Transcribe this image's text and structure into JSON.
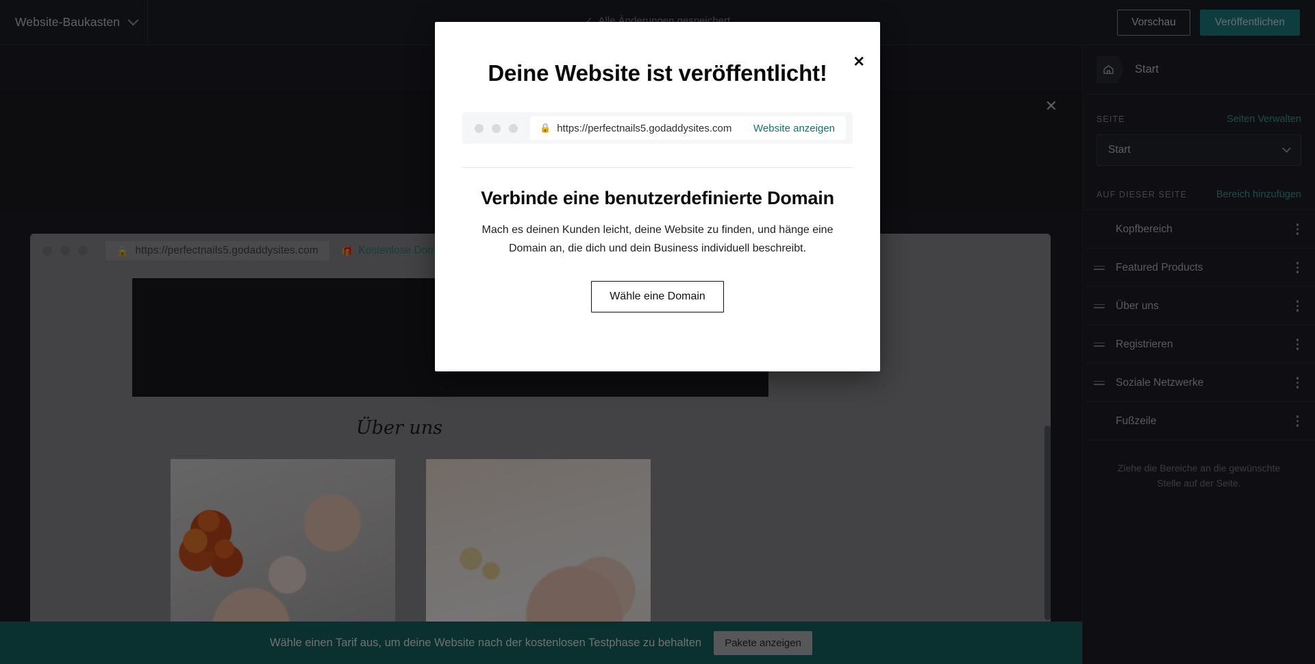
{
  "topbar": {
    "brand": "Website-Baukasten",
    "brand_chevron_icon": "chevron-down-icon",
    "saved_status": "Alle Änderungen gespeichert",
    "saved_check_icon": "check-icon",
    "preview_label": "Vorschau",
    "publish_label": "Veröffentlichen",
    "publish_color": "#127d7b"
  },
  "workarea": {
    "close_icon": "close-icon"
  },
  "preview": {
    "url": "https://perfectnails5.godaddysites.com",
    "lock_icon": "lock-icon",
    "gift_icon": "gift-icon",
    "free_domain_label": "Kostenlose Domain",
    "free_domain_color": "#1f7d74",
    "about_heading": "Über uns",
    "photos": [
      {
        "alt": "manicure-table-with-candles"
      },
      {
        "alt": "soft-spa-hands"
      },
      {
        "alt": "pink-nail-art-with-rose"
      }
    ]
  },
  "sidebar": {
    "page_icon": "home-icon",
    "page_name": "Start",
    "page_section_label": "SEITE",
    "manage_pages_link": "Seiten Verwalten",
    "page_select_value": "Start",
    "page_select_chevron_icon": "chevron-down-icon",
    "on_this_page_label": "AUF DIESER SEITE",
    "add_section_link": "Bereich hinzufügen",
    "sections": [
      {
        "name": "Kopfbereich",
        "draggable": false
      },
      {
        "name": "Featured Products",
        "draggable": true
      },
      {
        "name": "Über uns",
        "draggable": true
      },
      {
        "name": "Registrieren",
        "draggable": true
      },
      {
        "name": "Soziale Netzwerke",
        "draggable": true
      },
      {
        "name": "Fußzeile",
        "draggable": false
      }
    ],
    "hint": "Ziehe die Bereiche an die gewünschte Stelle auf der Seite.",
    "link_color": "#2aa18f"
  },
  "bottombar": {
    "message": "Wähle einen Tarif aus, um deine Website nach der kostenlosen Testphase zu behalten",
    "button_label": "Pakete anzeigen",
    "background": "#0f5f5c"
  },
  "modal": {
    "close_icon": "close-icon",
    "title": "Deine Website ist veröffentlicht!",
    "browser": {
      "lock_icon": "lock-icon",
      "url": "https://perfectnails5.godaddysites.com",
      "view_link": "Website anzeigen",
      "view_link_color": "#12726e"
    },
    "subtitle": "Verbinde eine benutzerdefinierte Domain",
    "body": "Mach es deinen Kunden leicht, deine Website zu finden, und hänge eine Domain an, die dich und dein Business individuell beschreibt.",
    "cta_label": "Wähle eine Domain"
  }
}
